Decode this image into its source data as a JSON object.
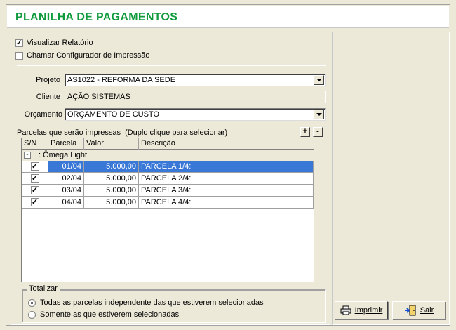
{
  "header": {
    "title": "PLANILHA DE PAGAMENTOS"
  },
  "options": {
    "visualizar_relatorio": {
      "label": "Visualizar Relatório",
      "checked": true
    },
    "chamar_configurador": {
      "label": "Chamar Configurador de Impressão",
      "checked": false
    }
  },
  "form": {
    "projeto": {
      "label": "Projeto",
      "value": "AS1022 - REFORMA DA SEDE"
    },
    "cliente": {
      "label": "Cliente",
      "value": "AÇÃO SISTEMAS"
    },
    "orcamento": {
      "label": "Orçamento",
      "value": "ORÇAMENTO DE CUSTO"
    }
  },
  "parcelas": {
    "caption": "Parcelas que serão impressas  (Duplo clique para selecionar)",
    "add_label": "+",
    "remove_label": "-",
    "columns": [
      "S/N",
      "Parcela",
      "Valor",
      "Descrição"
    ],
    "group": {
      "expander": "-",
      "label": ": Ômega Light"
    },
    "rows": [
      {
        "checked": true,
        "parcela": "01/04",
        "valor": "5.000,00",
        "descricao": "PARCELA 1/4:",
        "selected": true
      },
      {
        "checked": true,
        "parcela": "02/04",
        "valor": "5.000,00",
        "descricao": "PARCELA 2/4:",
        "selected": false
      },
      {
        "checked": true,
        "parcela": "03/04",
        "valor": "5.000,00",
        "descricao": "PARCELA 3/4:",
        "selected": false
      },
      {
        "checked": true,
        "parcela": "04/04",
        "valor": "5.000,00",
        "descricao": "PARCELA 4/4:",
        "selected": false
      }
    ]
  },
  "totalizar": {
    "title": "Totalizar",
    "options": [
      {
        "label": "Todas as parcelas independente das que estiverem selecionadas",
        "selected": true
      },
      {
        "label": "Somente as que estiverem selecionadas",
        "selected": false
      }
    ]
  },
  "buttons": {
    "imprimir": {
      "label": "Imprimir",
      "icon": "printer-icon"
    },
    "sair": {
      "label": "Sair",
      "icon": "exit-door-icon"
    }
  },
  "colors": {
    "title_green": "#0f9a3c",
    "selection_blue": "#3a78d8",
    "face": "#ece9d8"
  }
}
